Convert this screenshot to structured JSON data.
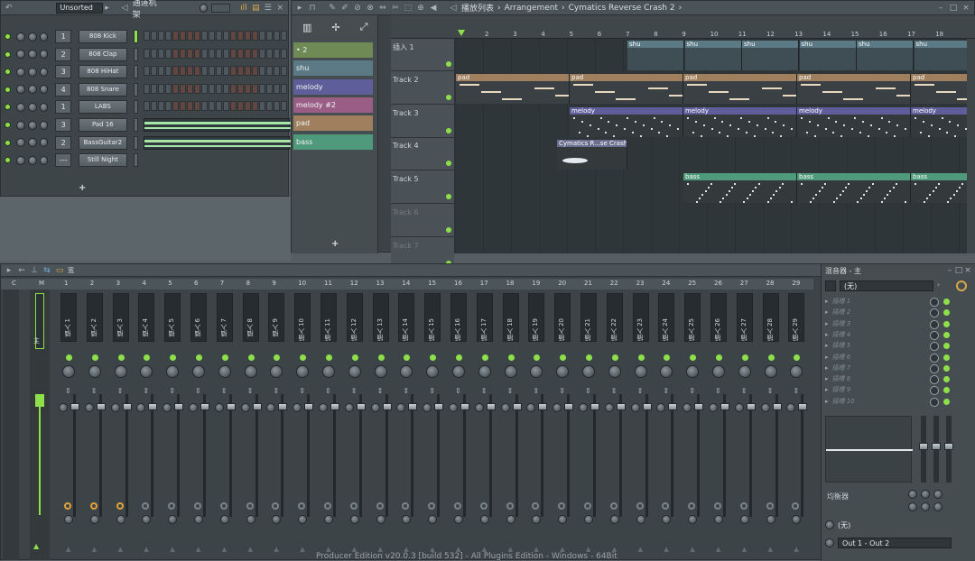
{
  "channel_rack": {
    "toolbar": {
      "filter": "Unsorted",
      "title": "通道机架"
    },
    "channels": [
      {
        "num": "1",
        "name": "808 Kick"
      },
      {
        "num": "2",
        "name": "808 Clap"
      },
      {
        "num": "3",
        "name": "808 HiHat"
      },
      {
        "num": "4",
        "name": "808 Snare"
      },
      {
        "num": "1",
        "name": "LABS"
      },
      {
        "num": "3",
        "name": "Pad 16"
      },
      {
        "num": "2",
        "name": "BassGuitar2"
      },
      {
        "num": "---",
        "name": "Still Night"
      }
    ],
    "add_label": "+"
  },
  "playlist": {
    "breadcrumb": [
      "播放列表",
      "Arrangement",
      "Cymatics Reverse Crash 2"
    ],
    "patterns": [
      {
        "label": "• 2",
        "color": "#6f8a55"
      },
      {
        "label": "shu",
        "color": "#5b7a85"
      },
      {
        "label": "melody",
        "color": "#5e5f9a"
      },
      {
        "label": "melody #2",
        "color": "#9a5e86"
      },
      {
        "label": "pad",
        "color": "#a07f5e"
      },
      {
        "label": "bass",
        "color": "#4f9a7c"
      }
    ],
    "add_label": "+",
    "bar_numbers": [
      "2",
      "3",
      "4",
      "5",
      "6",
      "7",
      "8",
      "9",
      "10",
      "11",
      "12",
      "13",
      "14",
      "15",
      "16",
      "17",
      "18"
    ],
    "tracks": [
      "插入 1",
      "Track 2",
      "Track 3",
      "Track 4",
      "Track 5",
      "Track 6",
      "Track 7"
    ],
    "clip_names": {
      "shu": "shu",
      "pad": "pad",
      "melody": "melody",
      "crash": "Cymatics R...se Crash 2",
      "bass": "bass"
    }
  },
  "mixer": {
    "side_title": "混音器 - 主",
    "preset": "(无)",
    "slots": [
      "插槽 1",
      "插槽 2",
      "插槽 3",
      "插槽 4",
      "插槽 5",
      "插槽 6",
      "插槽 7",
      "插槽 8",
      "插槽 9",
      "插槽 10"
    ],
    "eq_label": "均衡器",
    "send_none": "(无)",
    "output": "Out 1 - Out 2",
    "channel_numbers": [
      "C",
      "M",
      "1",
      "2",
      "3",
      "4",
      "5",
      "6",
      "7",
      "8",
      "9",
      "10",
      "11",
      "12",
      "13",
      "14",
      "15",
      "16",
      "17",
      "18",
      "19",
      "20",
      "21",
      "22",
      "23",
      "24",
      "25",
      "26",
      "27",
      "28",
      "29"
    ],
    "insert_names": [
      "插入 1",
      "插入 2",
      "插入 3",
      "插入 4",
      "插入 5",
      "插入 6",
      "插入 7",
      "插入 8",
      "插入 9",
      "插入 10",
      "插入 11",
      "插入 12",
      "插入 13",
      "插入 14",
      "插入 15",
      "插入 16",
      "插入 17",
      "插入 18",
      "插入 19",
      "插入 20",
      "插入 21",
      "插入 22",
      "插入 23",
      "插入 24",
      "插入 25",
      "插入 26",
      "插入 27",
      "插入 28",
      "插入 29"
    ],
    "toolbar_label": "宽",
    "master_label": "主"
  },
  "footer": "Producer Edition v20.0.3 [build 532] - All Plugins Edition - Windows - 64Bit"
}
